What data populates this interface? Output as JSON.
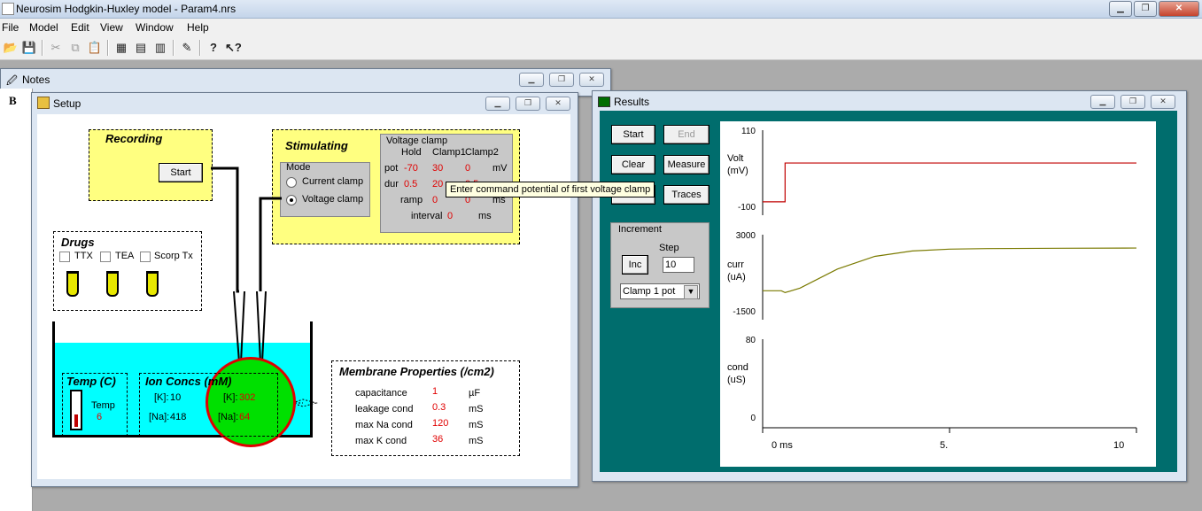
{
  "app": {
    "title": "Neurosim Hodgkin-Huxley model - Param4.nrs"
  },
  "menu": [
    "File",
    "Model",
    "Edit",
    "View",
    "Window",
    "Help"
  ],
  "toolbar_icons": [
    "open-icon",
    "save-icon",
    "cut-icon",
    "copy-icon",
    "paste-icon",
    "grid-icon",
    "table-icon",
    "report-icon",
    "chart-icon",
    "help-icon",
    "context-help-icon"
  ],
  "notes": {
    "title": "Notes",
    "bold_label": "B"
  },
  "setup": {
    "title": "Setup",
    "recording": {
      "label": "Recording",
      "start": "Start"
    },
    "stimulating": {
      "label": "Stimulating",
      "mode_label": "Mode",
      "mode_options": [
        "Current clamp",
        "Voltage clamp"
      ],
      "mode_selected": "Voltage clamp",
      "vclamp": {
        "title": "Voltage clamp",
        "col_hold": "Hold",
        "col_clamp1": "Clamp1",
        "col_clamp2": "Clamp2",
        "pot_label": "pot",
        "pot_hold": "-70",
        "pot_c1": "30",
        "pot_c2": "0",
        "pot_unit": "mV",
        "dur_label": "dur",
        "dur_hold": "0.5",
        "dur_c1": "20",
        "dur_c2": "0.5",
        "ramp_label": "ramp",
        "ramp_hold": "0",
        "ramp_c2": "0",
        "ramp_unit": "ms",
        "interval_label": "interval",
        "interval_value": "0",
        "interval_unit": "ms"
      }
    },
    "tooltip": "Enter command potential of first voltage clamp",
    "drugs": {
      "label": "Drugs",
      "items": [
        "TTX",
        "TEA",
        "Scorp Tx"
      ]
    },
    "temp": {
      "label": "Temp (C)",
      "value_label": "Temp",
      "value": "6"
    },
    "ion": {
      "label": "Ion Concs  (mM)",
      "k_out_label": "[K]:",
      "k_out": "10",
      "na_out_label": "[Na]:",
      "na_out": "418",
      "k_in_label": "[K]:",
      "k_in": "302",
      "na_in_label": "[Na]:",
      "na_in": "64"
    },
    "membrane": {
      "label": "Membrane Properties (/cm2)",
      "rows": [
        {
          "name": "capacitance",
          "value": "1",
          "unit": "µF"
        },
        {
          "name": "leakage cond",
          "value": "0.3",
          "unit": "mS"
        },
        {
          "name": "max Na cond",
          "value": "120",
          "unit": "mS"
        },
        {
          "name": "max K cond",
          "value": "36",
          "unit": "mS"
        }
      ]
    }
  },
  "results": {
    "title": "Results",
    "buttons": {
      "start": "Start",
      "end": "End",
      "clear": "Clear",
      "measure": "Measure",
      "traces": "Traces"
    },
    "increment": {
      "label": "Increment",
      "step_label": "Step",
      "step_value": "10",
      "inc": "Inc",
      "select": "Clamp 1 pot"
    },
    "plots": {
      "volt": {
        "label1": "Volt",
        "label2": "(mV)",
        "top": "110",
        "bottom": "-100"
      },
      "curr": {
        "label1": "curr",
        "label2": "(uA)",
        "top": "3000",
        "bottom": "-1500"
      },
      "cond": {
        "label1": "cond",
        "label2": "(uS)",
        "top": "80",
        "bottom": "0"
      },
      "x_ticks": [
        "0 ms",
        "5.",
        "10"
      ]
    },
    "colors": {
      "voltage_trace": "#c00000",
      "current_trace": "#7a7a00",
      "background": "#006d6d"
    }
  },
  "chart_data": {
    "type": "line",
    "x": [
      0,
      0.5,
      0.6,
      1,
      2,
      3,
      4,
      5,
      6,
      8,
      10
    ],
    "series": [
      {
        "name": "Volt",
        "values": [
          -70,
          -70,
          30,
          30,
          30,
          30,
          30,
          30,
          30,
          30,
          30
        ]
      },
      {
        "name": "curr",
        "values": [
          0,
          0,
          -100,
          150,
          1200,
          1900,
          2200,
          2300,
          2330,
          2350,
          2360
        ]
      }
    ],
    "xlabel": "",
    "ylim_volt": [
      -100,
      110
    ],
    "ylim_curr": [
      -1500,
      3000
    ]
  }
}
